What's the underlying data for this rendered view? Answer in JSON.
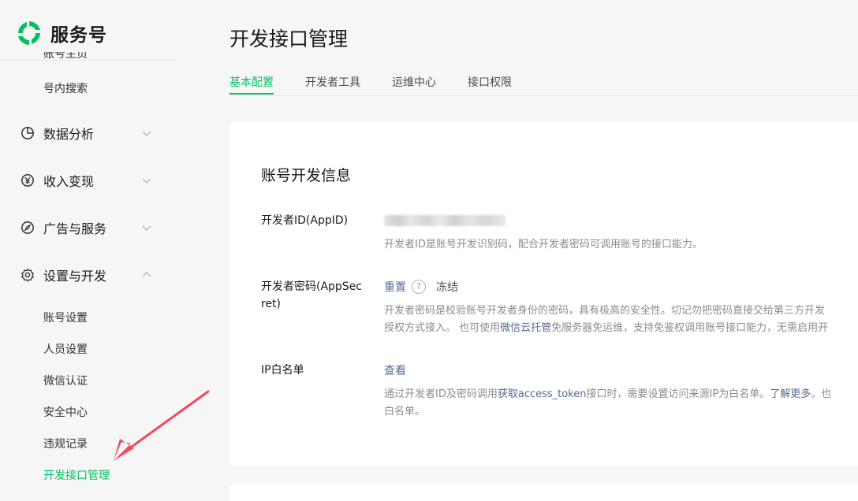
{
  "brand": {
    "name": "服务号"
  },
  "sidebar": {
    "cut_item": "账号主页",
    "search_item": "号内搜索",
    "groups": [
      {
        "label": "数据分析",
        "icon": "pie-chart-icon",
        "expanded": false
      },
      {
        "label": "收入变现",
        "icon": "yen-icon",
        "expanded": false
      },
      {
        "label": "广告与服务",
        "icon": "compass-icon",
        "expanded": false
      },
      {
        "label": "设置与开发",
        "icon": "gear-icon",
        "expanded": true
      }
    ],
    "settings_items": [
      {
        "label": "账号设置"
      },
      {
        "label": "人员设置"
      },
      {
        "label": "微信认证"
      },
      {
        "label": "安全中心"
      },
      {
        "label": "违规记录"
      },
      {
        "label": "开发接口管理",
        "active": true
      }
    ]
  },
  "main": {
    "title": "开发接口管理",
    "tabs": [
      {
        "label": "基本配置",
        "active": true
      },
      {
        "label": "开发者工具"
      },
      {
        "label": "运维中心"
      },
      {
        "label": "接口权限"
      }
    ],
    "card": {
      "title": "账号开发信息",
      "appid": {
        "label": "开发者ID(AppID)",
        "desc": "开发者ID是账号开发识别码，配合开发者密码可调用账号的接口能力。"
      },
      "secret": {
        "label_line1": "开发者密码(AppSec",
        "label_line2": "ret)",
        "reset": "重置",
        "help": "?",
        "freeze": "冻结",
        "desc_line1": "开发者密码是校验账号开发者身份的密码，具有极高的安全性。切记勿把密码直接交给第三方开发",
        "desc_line2_a": "授权方式接入。 也可使用",
        "desc_line2_link": "微信云托管",
        "desc_line2_b": "免服务器免运维，支持免鉴权调用账号接口能力，无需启用开"
      },
      "ip": {
        "label": "IP白名单",
        "view": "查看",
        "desc_line1_a": "通过开发者ID及密码调用",
        "desc_line1_link1": "获取access_token",
        "desc_line1_b": "接口时，需要设置访问来源IP为白名单。",
        "desc_line1_link2": "了解更多",
        "desc_line1_c": "。也",
        "desc_line2": "白名单。"
      }
    }
  },
  "colors": {
    "accent": "#07c160",
    "link": "#576b95",
    "annotation_arrow": "#f04a5d"
  }
}
